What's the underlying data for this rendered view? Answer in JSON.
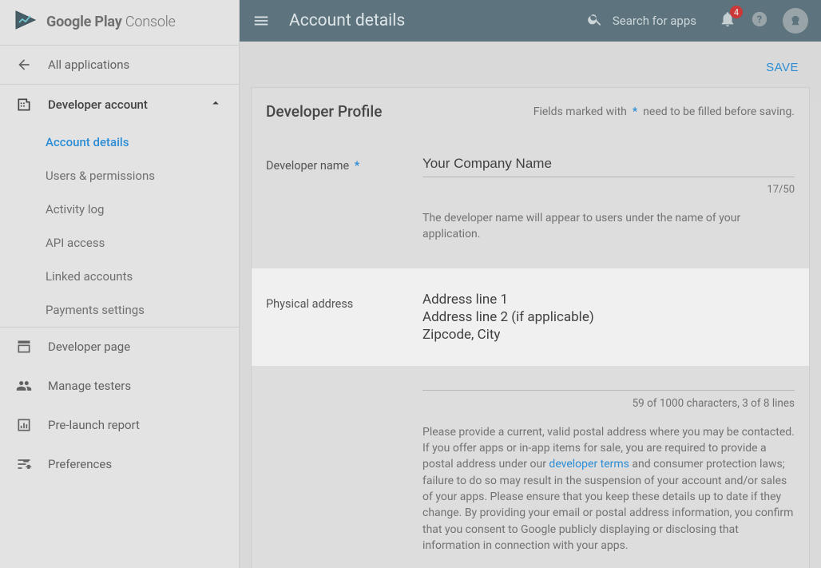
{
  "brand": {
    "text_bold": "Google Play",
    "text_light": "Console"
  },
  "sidebar": {
    "all_apps": "All applications",
    "dev_account": "Developer account",
    "subs": {
      "account_details": "Account details",
      "users_permissions": "Users & permissions",
      "activity_log": "Activity log",
      "api_access": "API access",
      "linked_accounts": "Linked accounts",
      "payments_settings": "Payments settings"
    },
    "developer_page": "Developer page",
    "manage_testers": "Manage testers",
    "prelaunch_report": "Pre-launch report",
    "preferences": "Preferences"
  },
  "header": {
    "title": "Account details",
    "search_placeholder": "Search for apps",
    "badge_count": "4"
  },
  "main": {
    "save_label": "SAVE",
    "card_title": "Developer Profile",
    "required_note_pre": "Fields marked with",
    "required_note_post": "need to be filled before saving.",
    "developer_name": {
      "label": "Developer name",
      "value": "Your Company Name",
      "counter": "17/50",
      "helper": "The developer name will appear to users under the name of your application."
    },
    "physical_address": {
      "label": "Physical address",
      "line1": "Address line 1",
      "line2": "Address line 2 (if applicable)",
      "line3": "Zipcode, City",
      "counter": "59 of 1000 characters, 3 of 8 lines",
      "helper_pre": "Please provide a current, valid postal address where you may be contacted. If you offer apps or in-app items for sale, you are required to provide a postal address under our ",
      "helper_link": "developer terms",
      "helper_post": " and consumer protection laws; failure to do so may result in the suspension of your account and/or sales of your apps. Please ensure that you keep these details up to date if they change. By providing your email or postal address information, you confirm that you consent to Google publicly displaying or disclosing that information in connection with your apps."
    }
  }
}
